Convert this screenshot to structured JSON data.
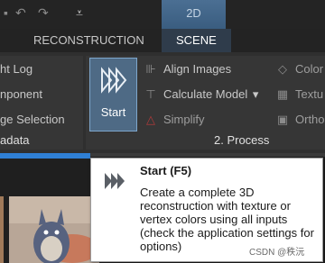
{
  "quick_access": {
    "context_tab_label": "2D"
  },
  "tabs": [
    {
      "label": "RECONSTRUCTION"
    },
    {
      "label": "SCENE"
    }
  ],
  "ribbon": {
    "left_group": {
      "items": [
        {
          "label": "ht Log"
        },
        {
          "label": "nponent"
        },
        {
          "label": "ge Selection"
        }
      ],
      "title": "adata"
    },
    "process_group": {
      "start_label": "Start",
      "items": [
        {
          "label": "Align Images"
        },
        {
          "label": "Calculate Model",
          "dropdown": "▾"
        },
        {
          "label": "Simplify"
        }
      ],
      "title": "2. Process"
    },
    "right_group": {
      "items": [
        {
          "label": "Color"
        },
        {
          "label": "Textu"
        },
        {
          "label": "Ortho"
        }
      ]
    }
  },
  "tooltip": {
    "title": "Start (F5)",
    "description": "Create a complete 3D reconstruction with texture or vertex colors using all inputs (check the application settings for options)"
  },
  "watermark": "CSDN @秩沅",
  "colors": {
    "accent": "#2f7fd4",
    "start_button": "#4e6a85",
    "ribbon": "#2f2f2f",
    "tooltip_bg": "#ffffff"
  }
}
